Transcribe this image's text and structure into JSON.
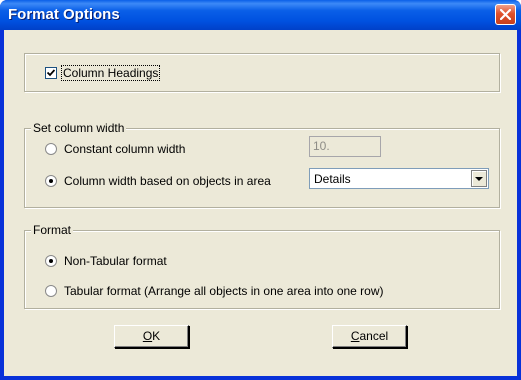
{
  "window": {
    "title": "Format Options"
  },
  "column_headings": {
    "label": "Column Headings",
    "checked": true
  },
  "column_width_group": {
    "label": "Set column width",
    "constant_option": {
      "label": "Constant column width",
      "selected": false,
      "value": "10."
    },
    "area_option": {
      "label": "Column width based on objects in area",
      "selected": true,
      "area_value": "Details"
    }
  },
  "format_group": {
    "label": "Format",
    "non_tabular": {
      "label": "Non-Tabular format",
      "selected": true
    },
    "tabular": {
      "label": "Tabular format (Arrange all objects in one area into one row)",
      "selected": false
    }
  },
  "buttons": {
    "ok_mnemonic": "O",
    "ok_rest": "K",
    "cancel_mnemonic": "C",
    "cancel_rest": "ancel"
  },
  "icons": {
    "close": "close-icon",
    "checkmark": "checkmark-icon",
    "dropdown": "chevron-down-icon"
  },
  "colors": {
    "titlebar": "#0a5fe8",
    "close_button": "#e0512c",
    "dialog_background": "#ece9d8"
  }
}
